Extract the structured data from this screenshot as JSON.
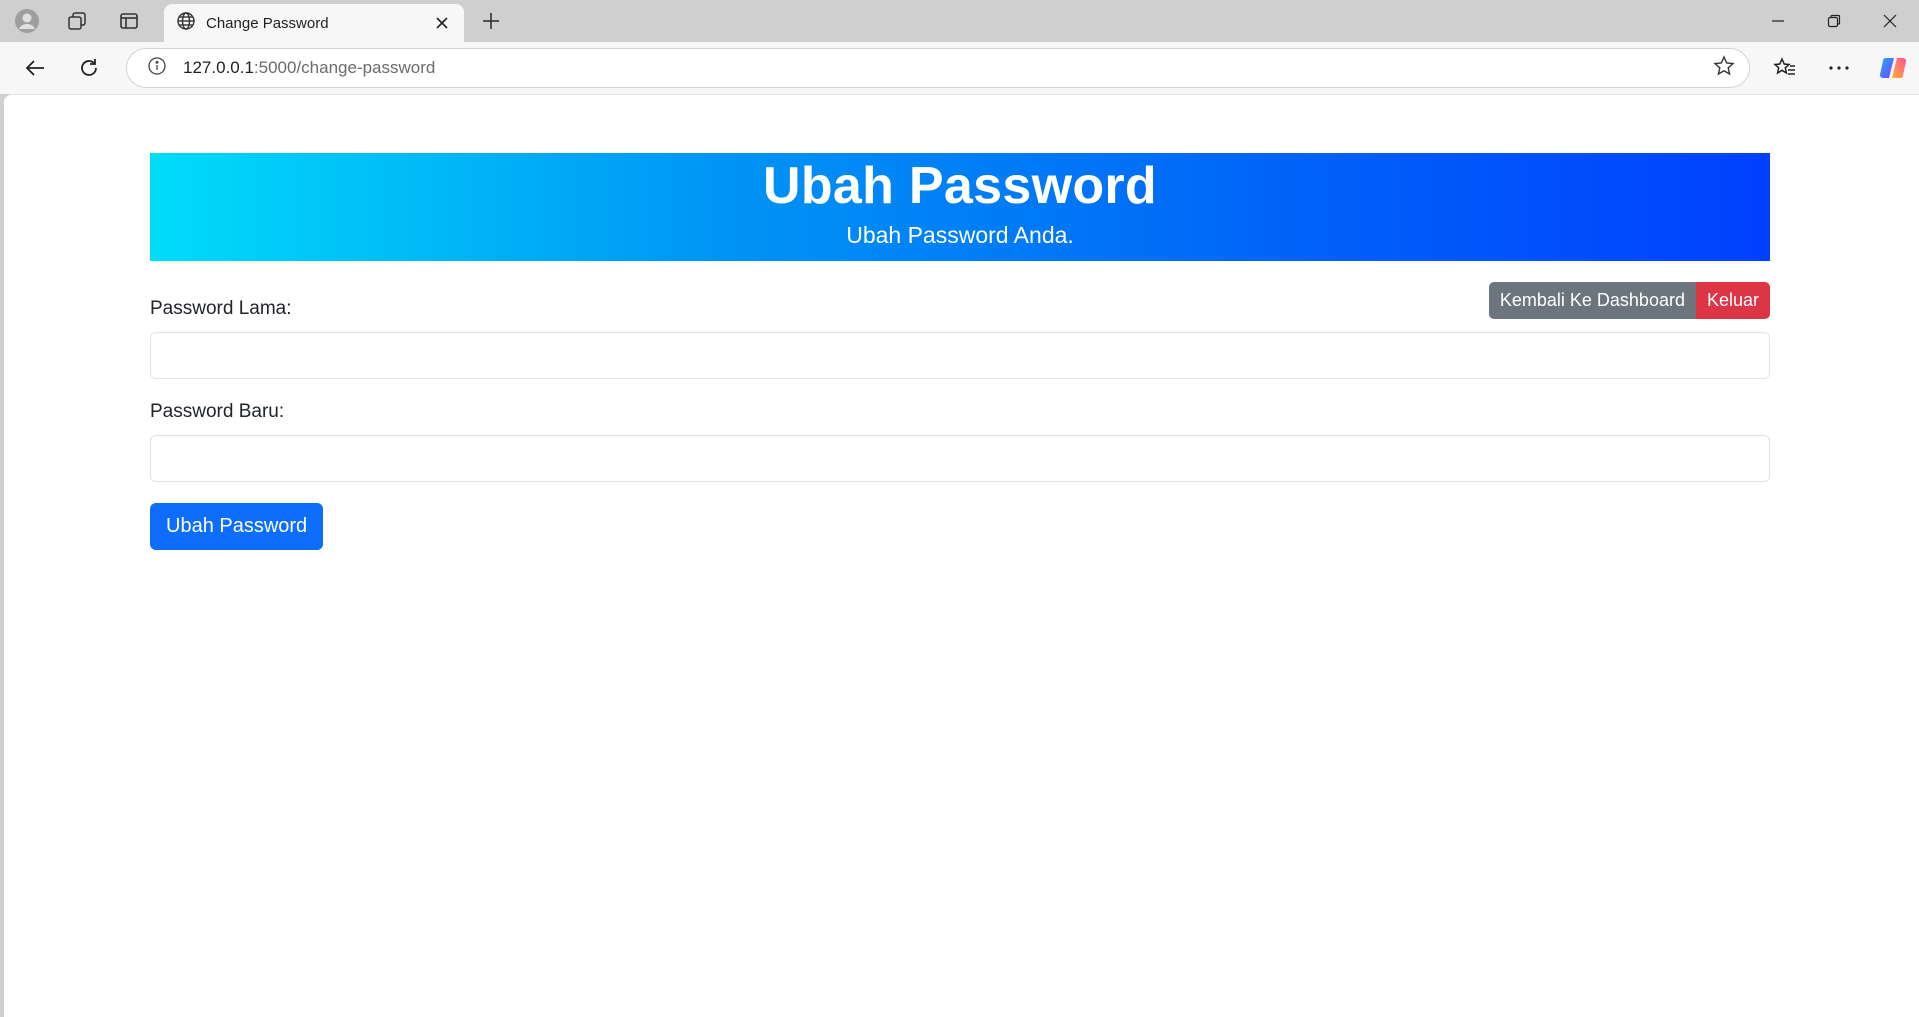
{
  "browser": {
    "tab_title": "Change Password",
    "url_host": "127.0.0.1",
    "url_path": ":5000/change-password"
  },
  "page": {
    "hero_title": "Ubah Password",
    "hero_subtitle": "Ubah Password Anda.",
    "back_button": "Kembali Ke Dashboard",
    "logout_button": "Keluar",
    "old_password_label": "Password Lama:",
    "new_password_label": "Password Baru:",
    "submit_button": "Ubah Password"
  },
  "colors": {
    "primary": "#0d6efd",
    "secondary": "#6c757d",
    "danger": "#dc3545",
    "hero_gradient_start": "#00dcfa",
    "hero_gradient_end": "#0040ff"
  }
}
